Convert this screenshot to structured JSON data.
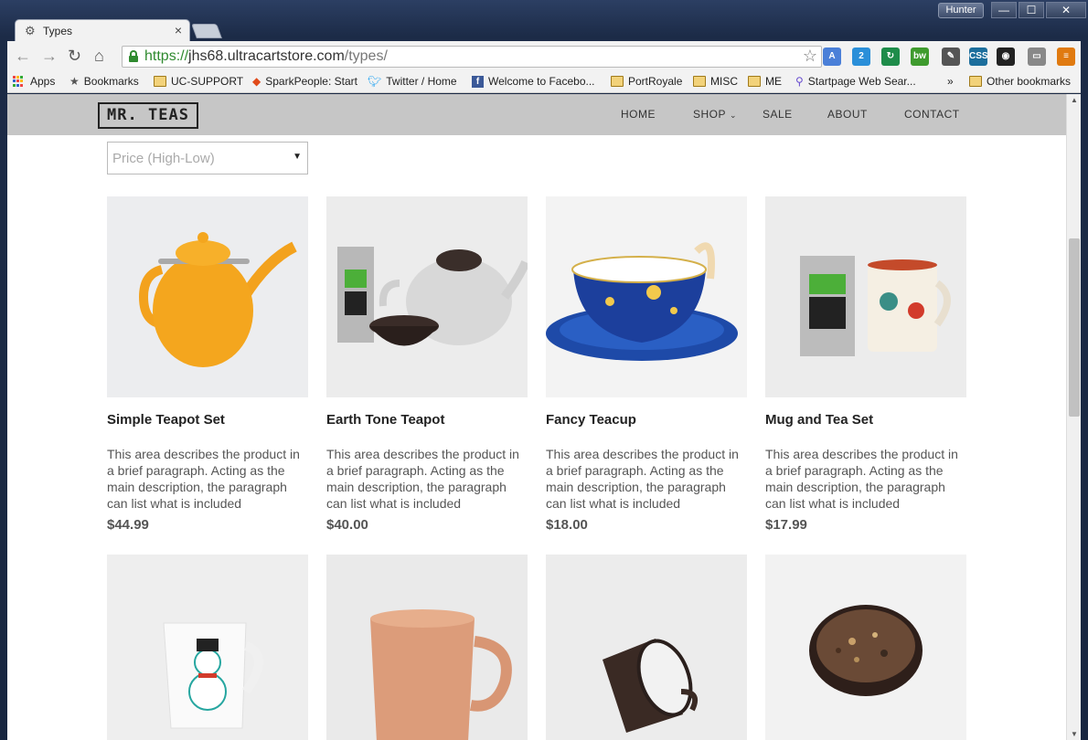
{
  "window": {
    "user_label": "Hunter",
    "minimize": "—",
    "maximize": "☐",
    "close": "✕"
  },
  "tab": {
    "title": "Types",
    "icon": "gear-icon"
  },
  "toolbar": {
    "url_proto": "https://",
    "url_host": "jhs68.ultracartstore.com",
    "url_path": "/types/",
    "extensions": [
      {
        "name": "translate-icon",
        "text": "A",
        "color": "#4a7fd8"
      },
      {
        "name": "skype-icon",
        "text": "2",
        "color": "#2a8fd9"
      },
      {
        "name": "refresh-ext-icon",
        "text": "↻",
        "color": "#1e8c4a"
      },
      {
        "name": "bw-icon",
        "text": "bw",
        "color": "#3f9b2e"
      },
      {
        "name": "eyedropper-icon",
        "text": "✎",
        "color": "#555555"
      },
      {
        "name": "css-icon",
        "text": "CSS",
        "color": "#1c6e9c"
      },
      {
        "name": "colorwheel-icon",
        "text": "◉",
        "color": "#222222"
      },
      {
        "name": "cast-icon",
        "text": "▭",
        "color": "#888888"
      },
      {
        "name": "menu-icon",
        "text": "≡",
        "color": "#e07a10"
      }
    ]
  },
  "bookmarks": {
    "items": [
      {
        "label": "Apps",
        "icon": "apps-icon"
      },
      {
        "label": "Bookmarks",
        "icon": "star-icon"
      },
      {
        "label": "UC-SUPPORT",
        "icon": "folder-icon"
      },
      {
        "label": "SparkPeople: Start",
        "icon": "sparkpeople-icon"
      },
      {
        "label": "Twitter / Home",
        "icon": "twitter-icon"
      },
      {
        "label": "Welcome to Facebo...",
        "icon": "facebook-icon"
      },
      {
        "label": "PortRoyale",
        "icon": "folder-icon"
      },
      {
        "label": "MISC",
        "icon": "folder-icon"
      },
      {
        "label": "ME",
        "icon": "folder-icon"
      },
      {
        "label": "Startpage Web Sear...",
        "icon": "startpage-icon"
      }
    ],
    "overflow": "»",
    "other": "Other bookmarks"
  },
  "site": {
    "logo": "MR. TEAS",
    "menu": [
      "HOME",
      "SHOP",
      "SALE",
      "ABOUT",
      "CONTACT"
    ],
    "sort": {
      "selected": "Price (High-Low)",
      "arrow": "▼"
    }
  },
  "products": [
    {
      "name": "Simple Teapot Set",
      "desc": "This area describes the product in a brief paragraph. Acting as the main description, the paragraph can list what is included",
      "price": "$44.99"
    },
    {
      "name": "Earth Tone Teapot",
      "desc": "This area describes the product in a brief paragraph. Acting as the main description, the paragraph can list what is included",
      "price": "$40.00"
    },
    {
      "name": "Fancy Teacup",
      "desc": "This area describes the product in a brief paragraph. Acting as the main description, the paragraph can list what is included",
      "price": "$18.00"
    },
    {
      "name": "Mug and Tea Set",
      "desc": "This area describes the product in a brief paragraph. Acting as the main description, the paragraph can list what is included",
      "price": "$17.99"
    }
  ]
}
